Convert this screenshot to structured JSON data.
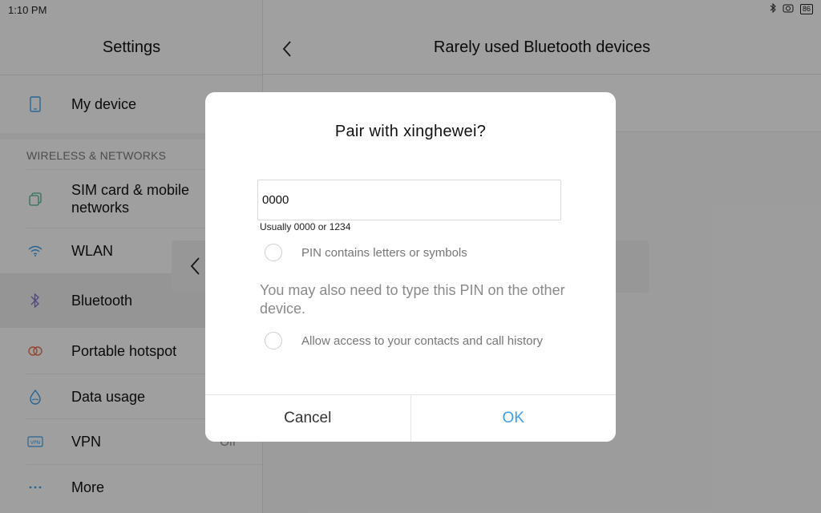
{
  "status_bar": {
    "time": "1:10 PM",
    "battery": "86"
  },
  "settings": {
    "title": "Settings",
    "my_device": "My device",
    "section_wireless": "WIRELESS & NETWORKS",
    "items": [
      {
        "label": "SIM card & mobile networks",
        "icon": "sim-card-icon"
      },
      {
        "label": "WLAN",
        "icon": "wifi-icon"
      },
      {
        "label": "Bluetooth",
        "icon": "bluetooth-icon"
      },
      {
        "label": "Portable hotspot",
        "icon": "hotspot-icon"
      },
      {
        "label": "Data usage",
        "icon": "data-usage-icon"
      },
      {
        "label": "VPN",
        "value": "Off",
        "icon": "vpn-icon"
      },
      {
        "label": "More",
        "icon": "more-icon"
      }
    ]
  },
  "detail": {
    "title": "Rarely used Bluetooth devices"
  },
  "dialog": {
    "title": "Pair with xinghewei?",
    "pin_value": "0000",
    "pin_hint": "Usually 0000 or 1234",
    "pin_letters_label": "PIN contains letters or symbols",
    "message": "You may also need to type this PIN on the other device.",
    "contacts_label": "Allow access to your contacts and call history",
    "cancel_label": "Cancel",
    "ok_label": "OK"
  },
  "colors": {
    "accent": "#3d9ee8",
    "overlay": "rgba(0,0,0,0.36)"
  }
}
